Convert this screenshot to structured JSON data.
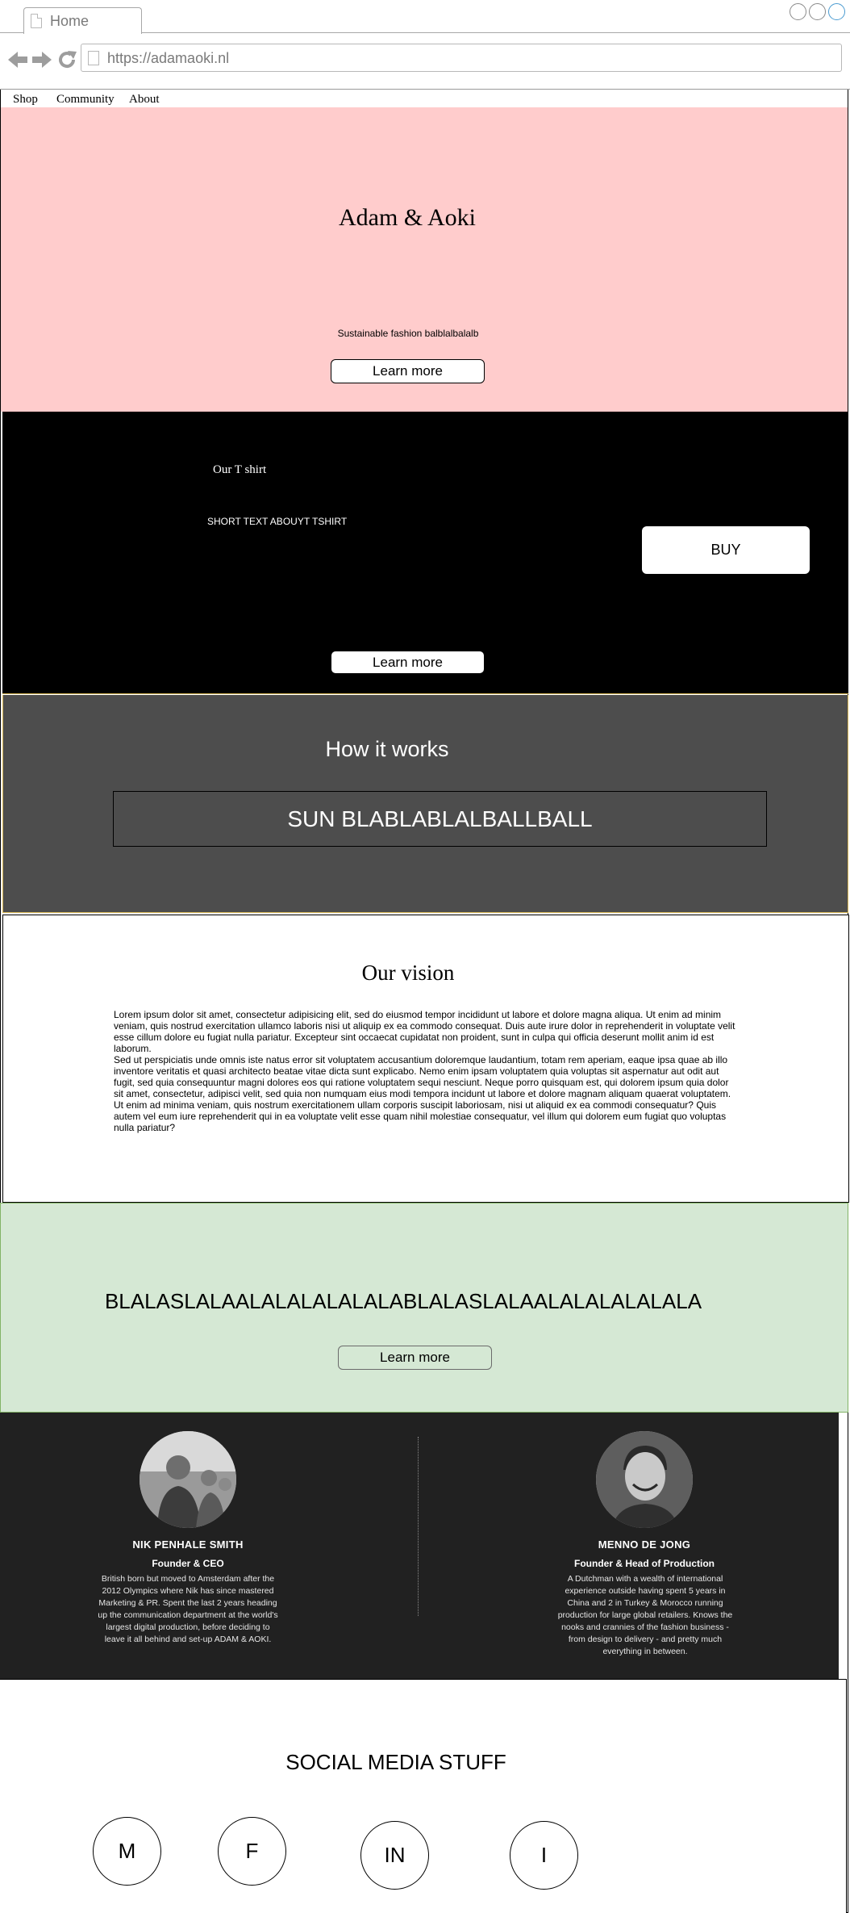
{
  "browser": {
    "tab_title": "Home",
    "url": "https://adamaoki.nl"
  },
  "nav": {
    "items": [
      {
        "label": "Shop"
      },
      {
        "label": "Community"
      },
      {
        "label": "About"
      }
    ]
  },
  "hero": {
    "title": "Adam & Aoki",
    "subtitle": "Sustainable fashion balblalbalalb",
    "cta": "Learn more",
    "background": "#ffcccc"
  },
  "tshirt": {
    "title": "Our T shirt",
    "text": "SHORT TEXT ABOUYT TSHIRT",
    "buy": "BUY",
    "cta": "Learn more"
  },
  "how": {
    "title": "How it works",
    "box": "SUN BLABLABLALBALLBALL"
  },
  "vision": {
    "title": "Our vision",
    "text": "Lorem ipsum dolor sit amet, consectetur adipisicing elit, sed do eiusmod tempor incididunt ut labore et dolore magna aliqua. Ut enim ad minim veniam, quis nostrud exercitation ullamco laboris nisi ut aliquip ex ea commodo consequat. Duis aute irure dolor in reprehenderit in voluptate velit esse cillum dolore eu fugiat nulla pariatur. Excepteur sint occaecat cupidatat non proident, sunt in culpa qui officia deserunt mollit anim id est laborum.\nSed ut perspiciatis unde omnis iste natus error sit voluptatem accusantium doloremque laudantium, totam rem aperiam, eaque ipsa quae ab illo inventore veritatis et quasi architecto beatae vitae dicta sunt explicabo. Nemo enim ipsam voluptatem quia voluptas sit aspernatur aut odit aut fugit, sed quia consequuntur magni dolores eos qui ratione voluptatem sequi nesciunt. Neque porro quisquam est, qui dolorem ipsum quia dolor sit amet, consectetur, adipisci velit, sed quia non numquam eius modi tempora incidunt ut labore et dolore magnam aliquam quaerat voluptatem. Ut enim ad minima veniam, quis nostrum exercitationem ullam corporis suscipit laboriosam, nisi ut aliquid ex ea commodi consequatur? Quis autem vel eum iure reprehenderit qui in ea voluptate velit esse quam nihil molestiae consequatur, vel illum qui dolorem eum fugiat quo voluptas nulla pariatur?"
  },
  "green": {
    "text": "BLALASLALAALALALALALALABLALASLALAALALALALALALA",
    "cta": "Learn more",
    "background": "#d5e8d4"
  },
  "team": {
    "members": [
      {
        "name": "NIK PENHALE SMITH",
        "role": "Founder & CEO",
        "bio": "British born but moved to Amsterdam after the 2012 Olympics where Nik has since mastered Marketing & PR. Spent the last 2 years heading up the communication department at the world's largest digital production, before deciding to leave it all behind and set-up ADAM & AOKI."
      },
      {
        "name": "MENNO DE JONG",
        "role": "Founder & Head of Production",
        "bio": "A Dutchman with a wealth of international experience outside having spent 5 years in China and 2 in Turkey & Morocco running production for large global retailers. Knows the nooks and crannies of the fashion business - from design to delivery - and pretty much everything in between."
      }
    ]
  },
  "social": {
    "title": "SOCIAL MEDIA STUFF",
    "icons": [
      {
        "label": "M"
      },
      {
        "label": "F"
      },
      {
        "label": "IN"
      },
      {
        "label": "I"
      }
    ]
  }
}
